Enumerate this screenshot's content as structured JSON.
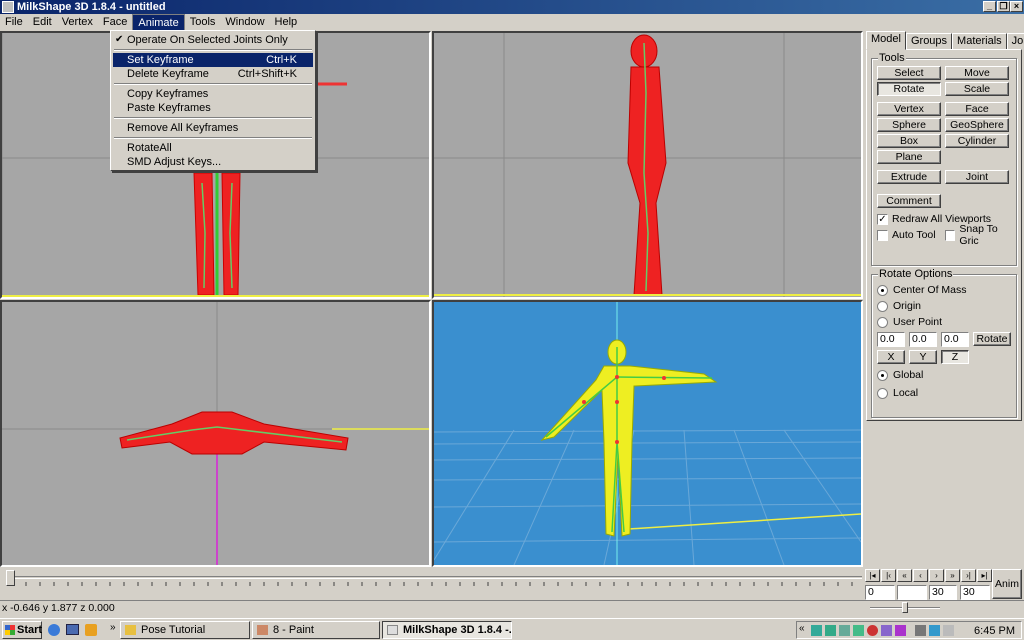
{
  "window": {
    "title": "MilkShape 3D 1.8.4 - untitled"
  },
  "menubar": [
    "File",
    "Edit",
    "Vertex",
    "Face",
    "Animate",
    "Tools",
    "Window",
    "Help"
  ],
  "dropdown": {
    "items": [
      {
        "label": "Operate On Selected Joints Only",
        "checked": true
      },
      {
        "label": "Set Keyframe",
        "shortcut": "Ctrl+K",
        "highlighted": true
      },
      {
        "label": "Delete Keyframe",
        "shortcut": "Ctrl+Shift+K"
      },
      {
        "label": "Copy Keyframes"
      },
      {
        "label": "Paste Keyframes"
      },
      {
        "label": "Remove All Keyframes"
      },
      {
        "label": "RotateAll"
      },
      {
        "label": "SMD Adjust Keys..."
      }
    ]
  },
  "panel": {
    "tabs": [
      "Model",
      "Groups",
      "Materials",
      "Joints"
    ],
    "tools_title": "Tools",
    "tools": {
      "select": "Select",
      "move": "Move",
      "rotate": "Rotate",
      "scale": "Scale",
      "vertex": "Vertex",
      "face": "Face",
      "sphere": "Sphere",
      "geosphere": "GeoSphere",
      "box": "Box",
      "cylinder": "Cylinder",
      "plane": "Plane",
      "extrude": "Extrude",
      "joint": "Joint",
      "comment": "Comment"
    },
    "checks": {
      "redraw": "Redraw All Viewports",
      "auto_tool": "Auto Tool",
      "snap": "Snap To Gric"
    },
    "rotate_title": "Rotate Options",
    "rotate": {
      "center_mass": "Center Of Mass",
      "origin": "Origin",
      "user_point": "User Point",
      "v1": "0.0",
      "v2": "0.0",
      "v3": "0.0",
      "rotate_btn": "Rotate",
      "x": "X",
      "y": "Y",
      "z": "Z",
      "global": "Global",
      "local": "Local"
    }
  },
  "anim": {
    "frame": "0",
    "from": "30",
    "to": "30",
    "anim_label": "Anim"
  },
  "status": "x -0.646 y 1.877 z 0.000",
  "taskbar": {
    "start": "Start",
    "tasks": [
      "Pose Tutorial",
      "8 - Paint",
      "MilkShape 3D 1.8.4 -..."
    ],
    "clock": "6:45 PM"
  }
}
